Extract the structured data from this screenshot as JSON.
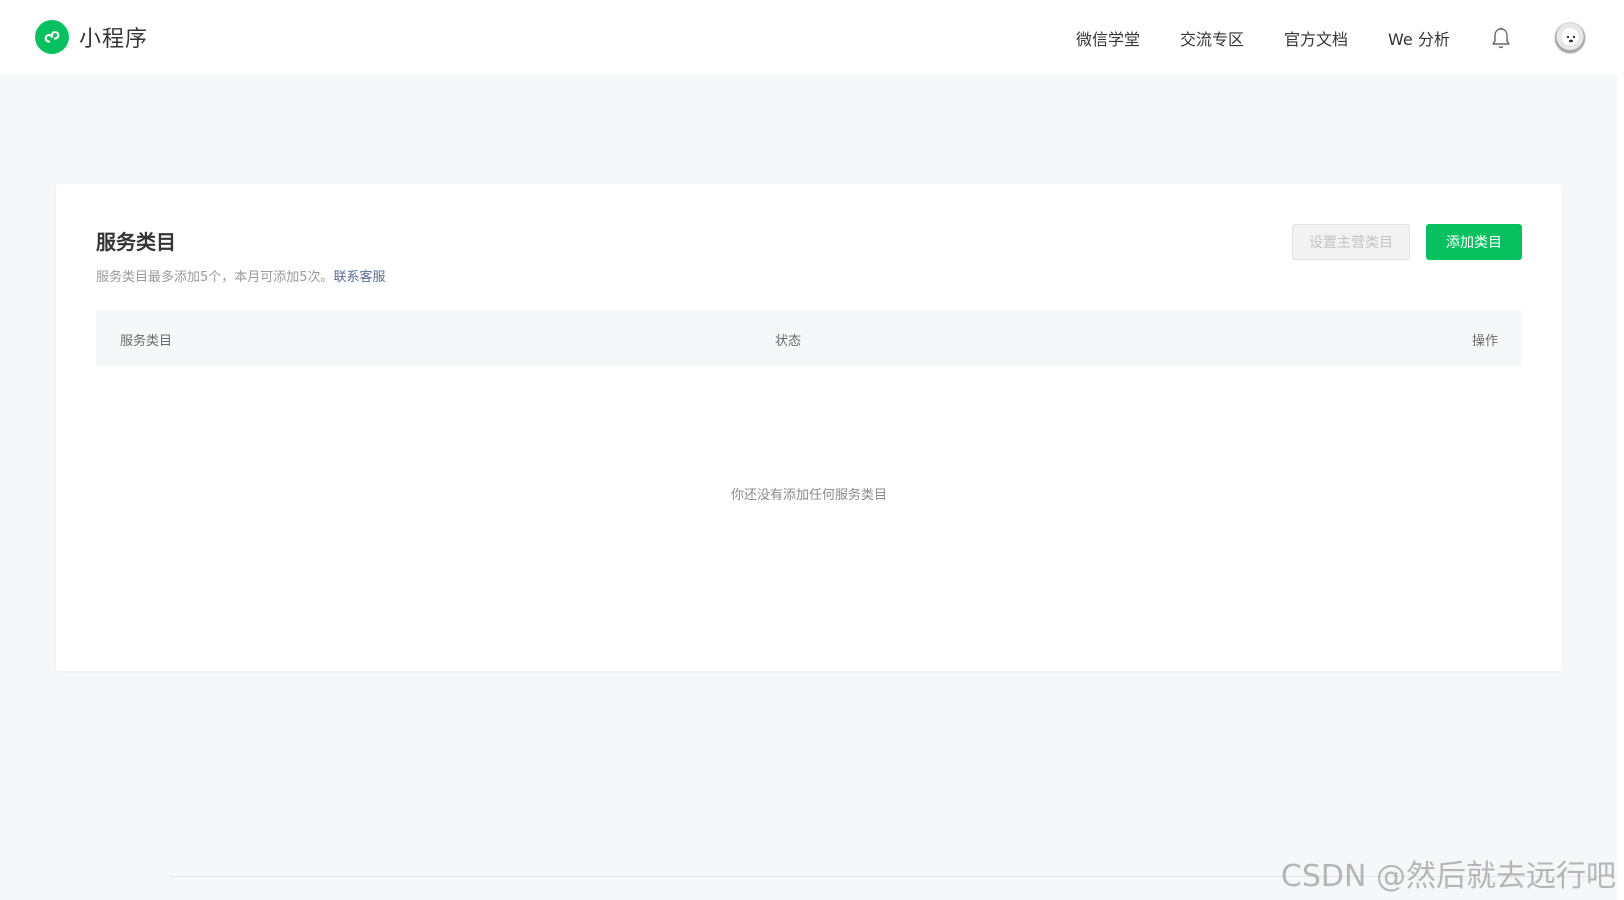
{
  "header": {
    "app_name": "小程序",
    "nav": [
      "微信学堂",
      "交流专区",
      "官方文档",
      "We 分析"
    ]
  },
  "card": {
    "title": "服务类目",
    "desc_prefix": "服务类目最多添加5个，本月可添加5次。",
    "desc_link": "联系客服",
    "set_main_button": "设置主营类目",
    "add_button": "添加类目",
    "columns": [
      "服务类目",
      "状态",
      "操作"
    ],
    "empty_text": "你还没有添加任何服务类目"
  },
  "watermark": "CSDN @然后就去远行吧",
  "colors": {
    "brand_green": "#07c160",
    "link_blue": "#576b95",
    "page_bg": "#f6f7f9"
  },
  "icons": {
    "logo": "mini-program-logo-icon",
    "notifications": "bell-icon",
    "avatar": "user-avatar"
  }
}
